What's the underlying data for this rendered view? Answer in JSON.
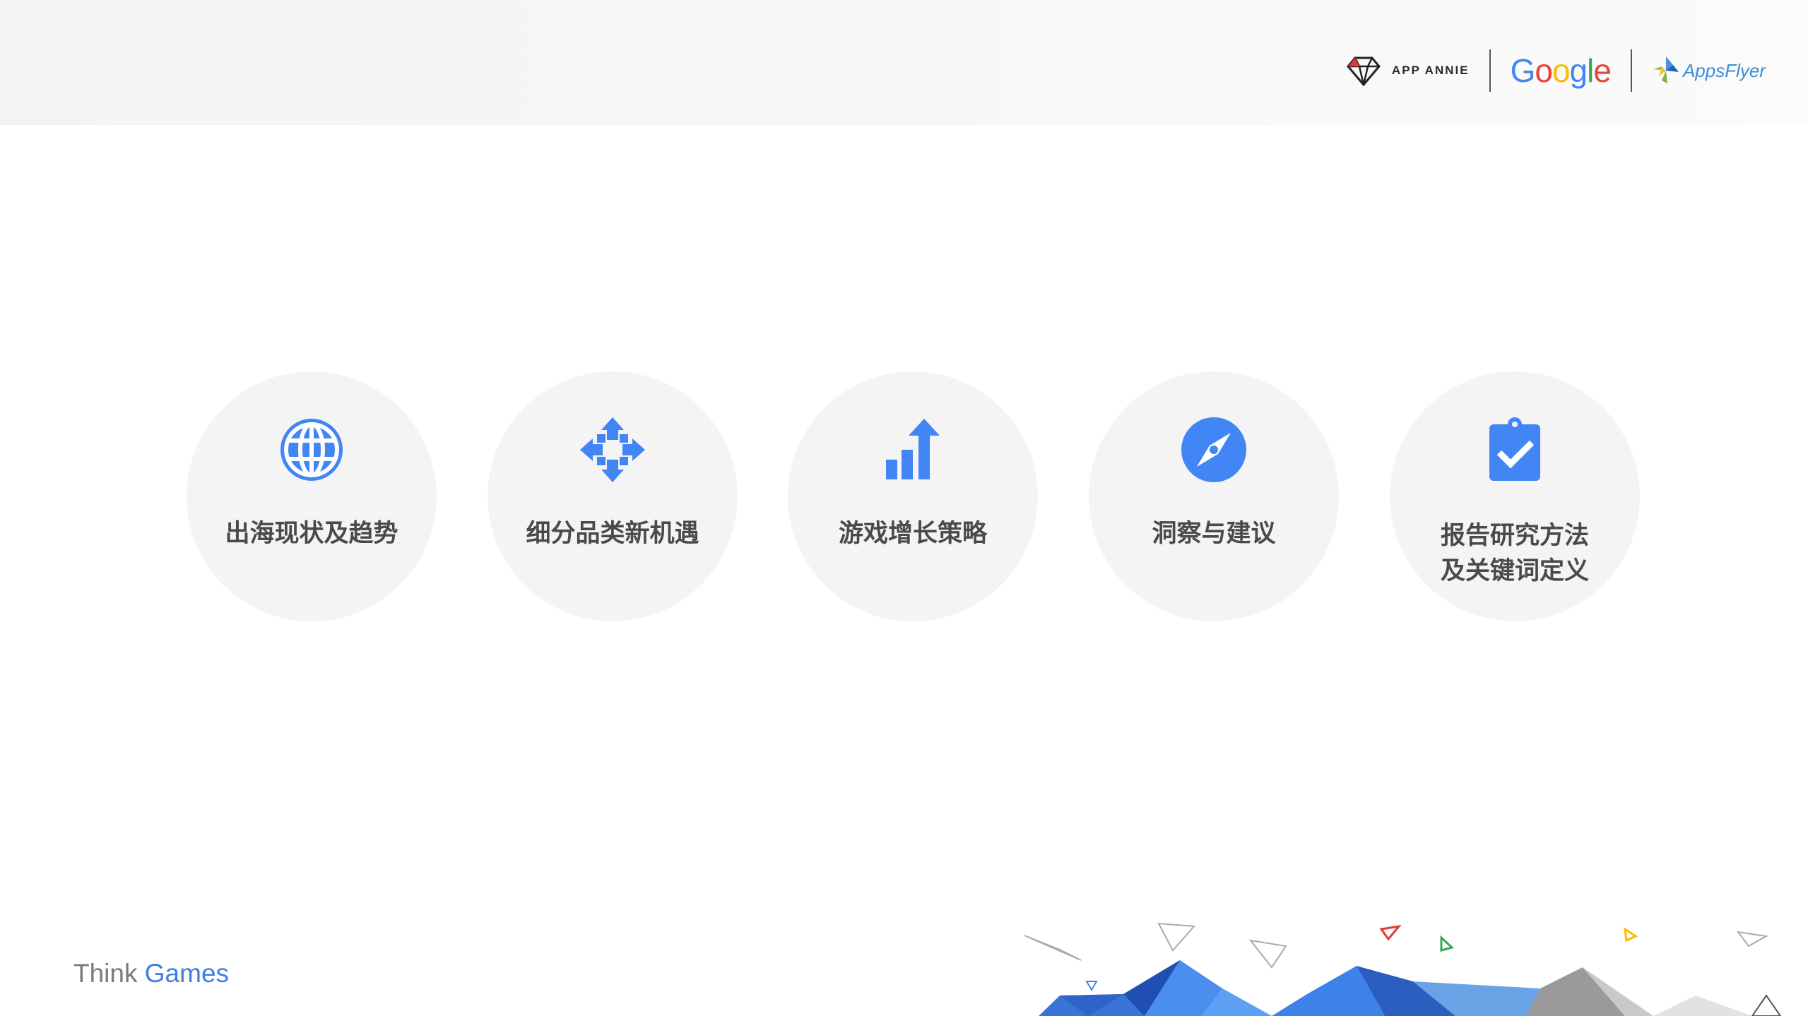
{
  "header": {
    "logos": {
      "app_annie": "APP ANNIE",
      "google": [
        "G",
        "o",
        "o",
        "g",
        "l",
        "e"
      ],
      "appsflyer": "AppsFlyer"
    }
  },
  "colors": {
    "icon_blue": "#4285f4",
    "google": [
      "#4285f4",
      "#ea4335",
      "#fbbc05",
      "#4285f4",
      "#34a853",
      "#ea4335"
    ]
  },
  "sections": [
    {
      "icon": "globe-icon",
      "label": "出海现状及趋势"
    },
    {
      "icon": "move-arrows-icon",
      "label": "细分品类新机遇"
    },
    {
      "icon": "bar-chart-growth-icon",
      "label": "游戏增长策略"
    },
    {
      "icon": "compass-icon",
      "label": "洞察与建议"
    },
    {
      "icon": "clipboard-check-icon",
      "label_line1": "报告研究方法",
      "label_line2": "及关键词定义"
    }
  ],
  "footer": {
    "think": "Think",
    "games": "Games"
  }
}
